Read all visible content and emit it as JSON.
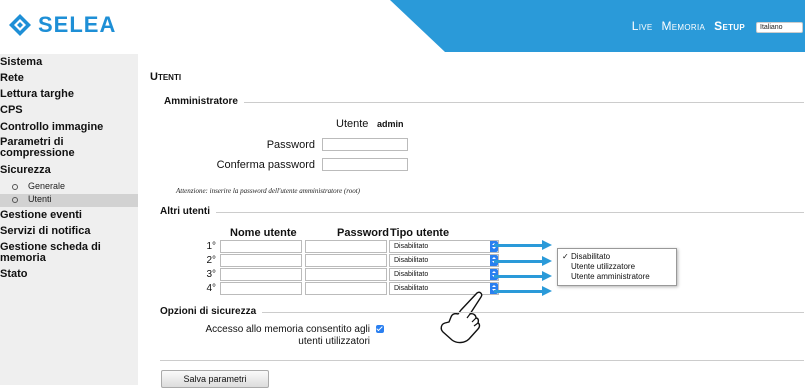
{
  "brand": {
    "name": "SELEA",
    "color": "#1e8fd6"
  },
  "topnav": {
    "items": [
      "Live",
      "Memoria",
      "Setup"
    ],
    "active": "Setup",
    "language": "Italiano"
  },
  "sidebar": {
    "items": [
      {
        "label": "Sistema"
      },
      {
        "label": "Rete"
      },
      {
        "label": "Lettura targhe"
      },
      {
        "label": "CPS"
      },
      {
        "label": "Controllo immagine"
      },
      {
        "label": "Parametri di compressione"
      },
      {
        "label": "Sicurezza"
      },
      {
        "label": "Generale"
      },
      {
        "label": "Utenti"
      },
      {
        "label": "Gestione eventi"
      },
      {
        "label": "Servizi di notifica"
      },
      {
        "label": "Gestione scheda di memoria"
      },
      {
        "label": "Stato"
      }
    ]
  },
  "page": {
    "title": "Utenti"
  },
  "admin": {
    "legend": "Amministratore",
    "user_label": "Utente",
    "user_value": "admin",
    "password_label": "Password",
    "confirm_label": "Conferma password",
    "note": "Attenzione: inserire la password dell'utente amministratore (root)"
  },
  "others": {
    "legend": "Altri utenti",
    "headers": [
      "Nome utente",
      "Password",
      "Tipo utente"
    ],
    "rows": [
      {
        "num": "1°",
        "type": "Disabilitato"
      },
      {
        "num": "2°",
        "type": "Disabilitato"
      },
      {
        "num": "3°",
        "type": "Disabilitato"
      },
      {
        "num": "4°",
        "type": "Disabilitato"
      }
    ],
    "dropdown_options": [
      "Disabilitato",
      "Utente utilizzatore",
      "Utente amministratore"
    ],
    "dropdown_selected": "Disabilitato",
    "check_mark": "✓"
  },
  "security": {
    "legend": "Opzioni di sicurezza",
    "memory_access_label_1": "Accesso allo memoria consentito agli",
    "memory_access_label_2": "utenti utilizzatori",
    "memory_access_checked": true
  },
  "save_button": "Salva parametri",
  "accent": "#2a9ad9"
}
